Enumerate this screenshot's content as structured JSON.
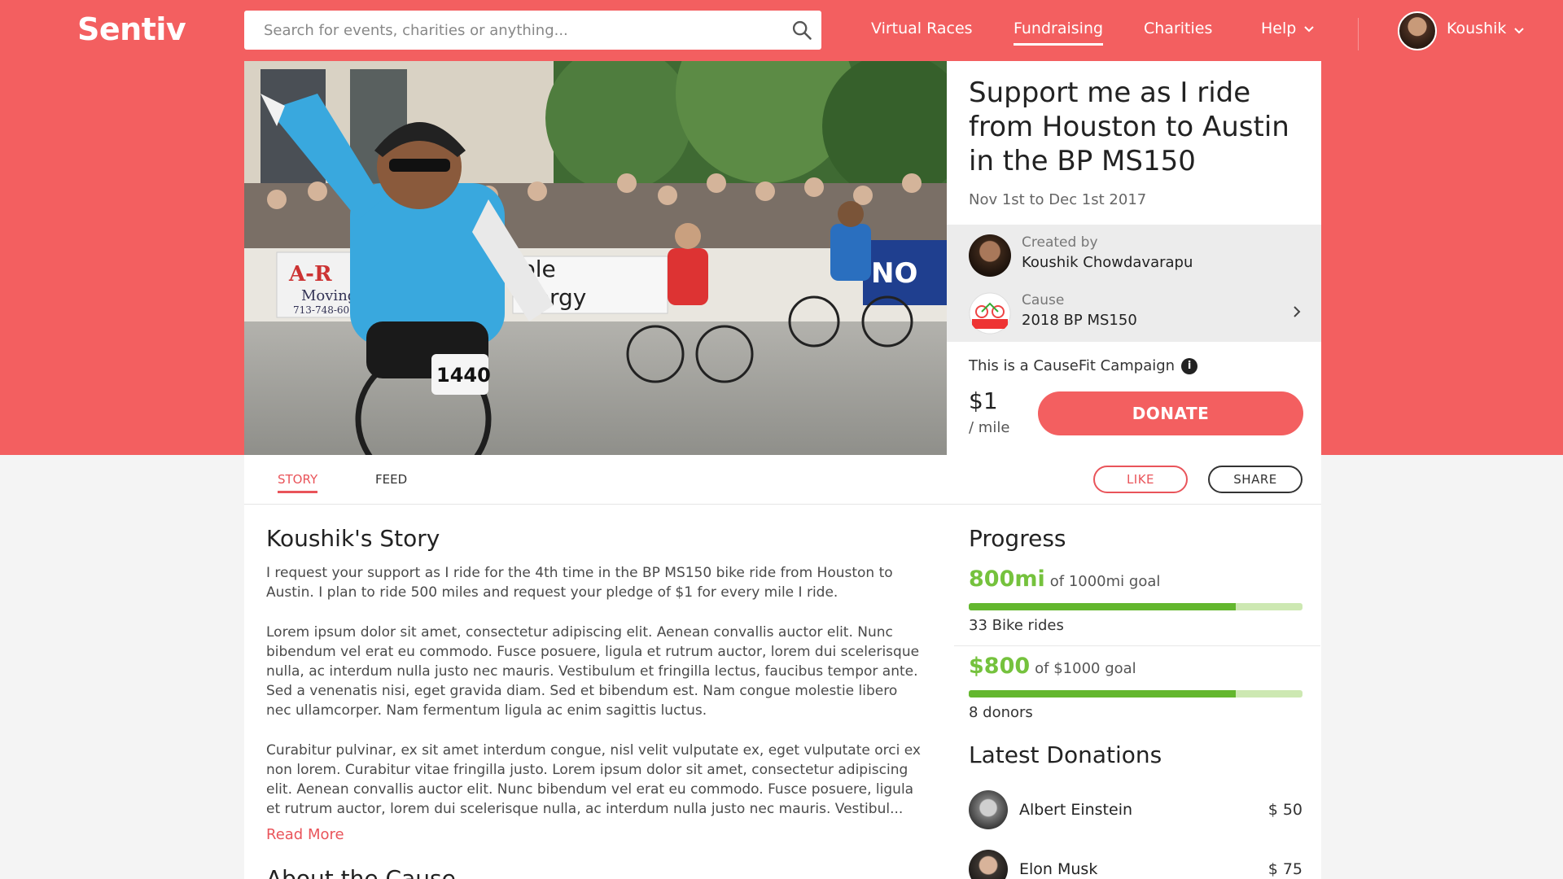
{
  "header": {
    "logo": "Sentiv",
    "search_placeholder": "Search for events, charities or anything...",
    "nav": [
      {
        "label": "Virtual Races",
        "active": false
      },
      {
        "label": "Fundraising",
        "active": true
      },
      {
        "label": "Charities",
        "active": false
      },
      {
        "label": "Help",
        "active": false
      }
    ],
    "user_name": "Koushik"
  },
  "campaign": {
    "title": "Support me as I ride from Houston to Austin in the BP MS150",
    "dates": "Nov 1st to Dec 1st 2017",
    "created_by_label": "Created by",
    "creator": "Koushik Chowdavarapu",
    "cause_label": "Cause",
    "cause": "2018 BP MS150",
    "causefit_note": "This is a CauseFit Campaign",
    "rate_amount": "$1",
    "rate_unit": "/ mile",
    "donate_label": "DONATE",
    "photo_sign_texts": [
      "A-R",
      "Moving",
      "713-748-6024",
      "1440",
      "ple",
      "nergy",
      "NO"
    ]
  },
  "tabs": {
    "story": "STORY",
    "feed": "FEED",
    "like": "LIKE",
    "share": "SHARE"
  },
  "story": {
    "title": "Koushik's Story",
    "paragraphs": [
      "I request your support as I ride for the 4th time in the BP MS150 bike ride from Houston to Austin. I plan to ride 500 miles and request your pledge of $1 for every mile I ride.",
      "Lorem ipsum dolor sit amet, consectetur adipiscing elit. Aenean convallis auctor elit. Nunc bibendum vel erat eu commodo. Fusce posuere, ligula et rutrum auctor, lorem dui scelerisque nulla, ac interdum nulla justo nec mauris. Vestibulum et fringilla lectus, faucibus tempor ante. Sed a venenatis nisi, eget gravida diam. Sed et bibendum est. Nam congue molestie libero nec ullamcorper. Nam fermentum ligula ac enim sagittis luctus.",
      "Curabitur pulvinar, ex sit amet interdum congue, nisl velit vulputate ex, eget vulputate orci ex non lorem. Curabitur vitae fringilla justo. Lorem ipsum dolor sit amet, consectetur adipiscing elit. Aenean convallis auctor elit. Nunc bibendum vel erat eu commodo. Fusce posuere, ligula et rutrum auctor, lorem dui scelerisque nulla, ac interdum nulla justo nec mauris. Vestibul..."
    ],
    "read_more": "Read More",
    "about_title": "About the Cause"
  },
  "progress": {
    "title": "Progress",
    "distance_value": "800mi",
    "distance_goal": "of 1000mi goal",
    "distance_fraction": 0.8,
    "rides": "33 Bike rides",
    "money_value": "$800",
    "money_goal": "of $1000 goal",
    "money_fraction": 0.8,
    "donors": "8 donors",
    "bar_color": "#63b72e",
    "bar_track_color": "#cde8b2",
    "value_color": "#75c23d"
  },
  "donations": {
    "title": "Latest Donations",
    "items": [
      {
        "name": "Albert Einstein",
        "amount": "$ 50"
      },
      {
        "name": "Elon Musk",
        "amount": "$ 75"
      }
    ]
  },
  "colors": {
    "brand": "#f35f60",
    "accent_text": "#e9545a"
  }
}
